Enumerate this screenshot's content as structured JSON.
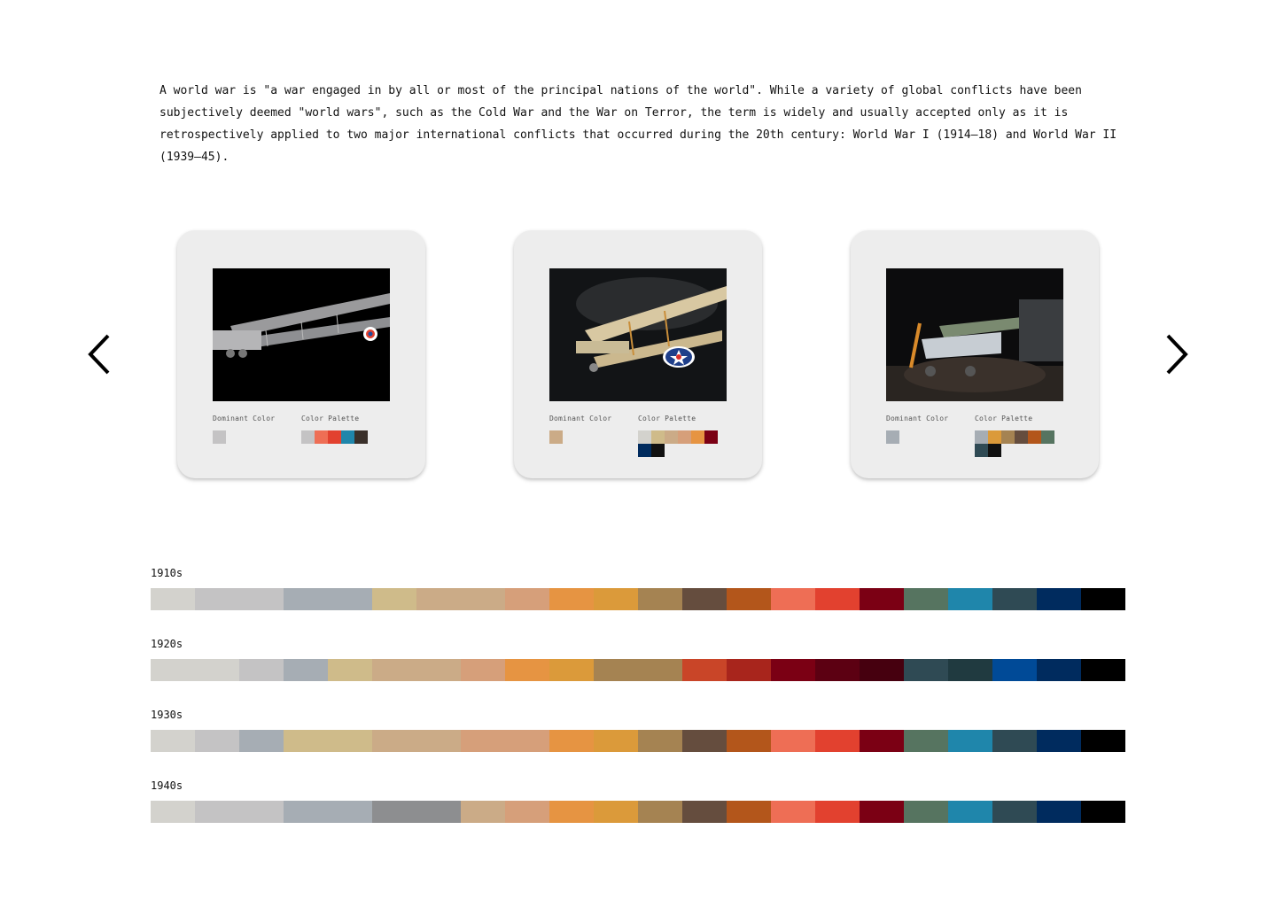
{
  "intro": {
    "text": "A world war is \"a war engaged in by all or most of the principal nations of the world\". While a variety of global conflicts have been subjectively deemed \"world wars\", such as the Cold War and the War on Terror, the term is widely and usually accepted only as it is retrospectively applied to two major international conflicts that occurred during the 20th century: World War I (1914–18) and World War II (1939–45)."
  },
  "carousel": {
    "prev_icon": "chevron-left-icon",
    "next_icon": "chevron-right-icon",
    "cards": [
      {
        "dominant_label": "Dominant Color",
        "palette_label": "Color Palette",
        "dominant_color": "#c4c3c4",
        "palette": [
          "#c4c3c4",
          "#ee6e55",
          "#e2412f",
          "#1f86ab",
          "#3a302a"
        ]
      },
      {
        "dominant_label": "Dominant Color",
        "palette_label": "Color Palette",
        "dominant_color": "#cbab87",
        "palette": [
          "#d3d2cd",
          "#cfbb8a",
          "#cbab87",
          "#d69f7a",
          "#e69442",
          "#7b0014",
          "#002b5e",
          "#111111"
        ]
      },
      {
        "dominant_label": "Dominant Color",
        "palette_label": "Color Palette",
        "dominant_color": "#a6adb4",
        "palette": [
          "#a6adb4",
          "#db9a3a",
          "#a58352",
          "#654d3e",
          "#b3561b",
          "#567460",
          "#2f4a54",
          "#111111"
        ]
      }
    ]
  },
  "decades": [
    {
      "label": "1910s",
      "swatches": [
        {
          "color": "#d3d2cd",
          "units": 1
        },
        {
          "color": "#c4c3c4",
          "units": 2
        },
        {
          "color": "#a6adb4",
          "units": 2
        },
        {
          "color": "#cfbb8a",
          "units": 1
        },
        {
          "color": "#cbab87",
          "units": 2
        },
        {
          "color": "#d69f7a",
          "units": 1
        },
        {
          "color": "#e69442",
          "units": 1
        },
        {
          "color": "#db9a3a",
          "units": 1
        },
        {
          "color": "#a58352",
          "units": 1
        },
        {
          "color": "#654d3e",
          "units": 1
        },
        {
          "color": "#b3561b",
          "units": 1
        },
        {
          "color": "#ee6e55",
          "units": 1
        },
        {
          "color": "#e2412f",
          "units": 1
        },
        {
          "color": "#7b0014",
          "units": 1
        },
        {
          "color": "#567460",
          "units": 1
        },
        {
          "color": "#1f86ab",
          "units": 1
        },
        {
          "color": "#2f4a54",
          "units": 1
        },
        {
          "color": "#002b5e",
          "units": 1
        },
        {
          "color": "#000000",
          "units": 1
        }
      ]
    },
    {
      "label": "1920s",
      "swatches": [
        {
          "color": "#d3d2cd",
          "units": 2
        },
        {
          "color": "#c4c3c4",
          "units": 1
        },
        {
          "color": "#a6adb4",
          "units": 1
        },
        {
          "color": "#cfbb8a",
          "units": 1
        },
        {
          "color": "#cbab87",
          "units": 2
        },
        {
          "color": "#d69f7a",
          "units": 1
        },
        {
          "color": "#e69442",
          "units": 1
        },
        {
          "color": "#db9a3a",
          "units": 1
        },
        {
          "color": "#a58352",
          "units": 2
        },
        {
          "color": "#c94528",
          "units": 1
        },
        {
          "color": "#a8251c",
          "units": 1
        },
        {
          "color": "#7b0014",
          "units": 1
        },
        {
          "color": "#5c0012",
          "units": 1
        },
        {
          "color": "#46000f",
          "units": 1
        },
        {
          "color": "#2f4a54",
          "units": 1
        },
        {
          "color": "#203a40",
          "units": 1
        },
        {
          "color": "#004a97",
          "units": 1
        },
        {
          "color": "#002b5e",
          "units": 1
        },
        {
          "color": "#000000",
          "units": 1
        }
      ]
    },
    {
      "label": "1930s",
      "swatches": [
        {
          "color": "#d3d2cd",
          "units": 1
        },
        {
          "color": "#c4c3c4",
          "units": 1
        },
        {
          "color": "#a6adb4",
          "units": 1
        },
        {
          "color": "#cfbb8a",
          "units": 2
        },
        {
          "color": "#cbab87",
          "units": 2
        },
        {
          "color": "#d69f7a",
          "units": 2
        },
        {
          "color": "#e69442",
          "units": 1
        },
        {
          "color": "#db9a3a",
          "units": 1
        },
        {
          "color": "#a58352",
          "units": 1
        },
        {
          "color": "#654d3e",
          "units": 1
        },
        {
          "color": "#b3561b",
          "units": 1
        },
        {
          "color": "#ee6e55",
          "units": 1
        },
        {
          "color": "#e2412f",
          "units": 1
        },
        {
          "color": "#7b0014",
          "units": 1
        },
        {
          "color": "#567460",
          "units": 1
        },
        {
          "color": "#1f86ab",
          "units": 1
        },
        {
          "color": "#2f4a54",
          "units": 1
        },
        {
          "color": "#002b5e",
          "units": 1
        },
        {
          "color": "#000000",
          "units": 1
        }
      ]
    },
    {
      "label": "1940s",
      "swatches": [
        {
          "color": "#d3d2cd",
          "units": 1
        },
        {
          "color": "#c4c3c4",
          "units": 2
        },
        {
          "color": "#a6adb4",
          "units": 2
        },
        {
          "color": "#8d8e90",
          "units": 2
        },
        {
          "color": "#cbab87",
          "units": 1
        },
        {
          "color": "#d69f7a",
          "units": 1
        },
        {
          "color": "#e69442",
          "units": 1
        },
        {
          "color": "#db9a3a",
          "units": 1
        },
        {
          "color": "#a58352",
          "units": 1
        },
        {
          "color": "#654d3e",
          "units": 1
        },
        {
          "color": "#b3561b",
          "units": 1
        },
        {
          "color": "#ee6e55",
          "units": 1
        },
        {
          "color": "#e2412f",
          "units": 1
        },
        {
          "color": "#7b0014",
          "units": 1
        },
        {
          "color": "#567460",
          "units": 1
        },
        {
          "color": "#1f86ab",
          "units": 1
        },
        {
          "color": "#2f4a54",
          "units": 1
        },
        {
          "color": "#002b5e",
          "units": 1
        },
        {
          "color": "#000000",
          "units": 1
        }
      ]
    }
  ]
}
